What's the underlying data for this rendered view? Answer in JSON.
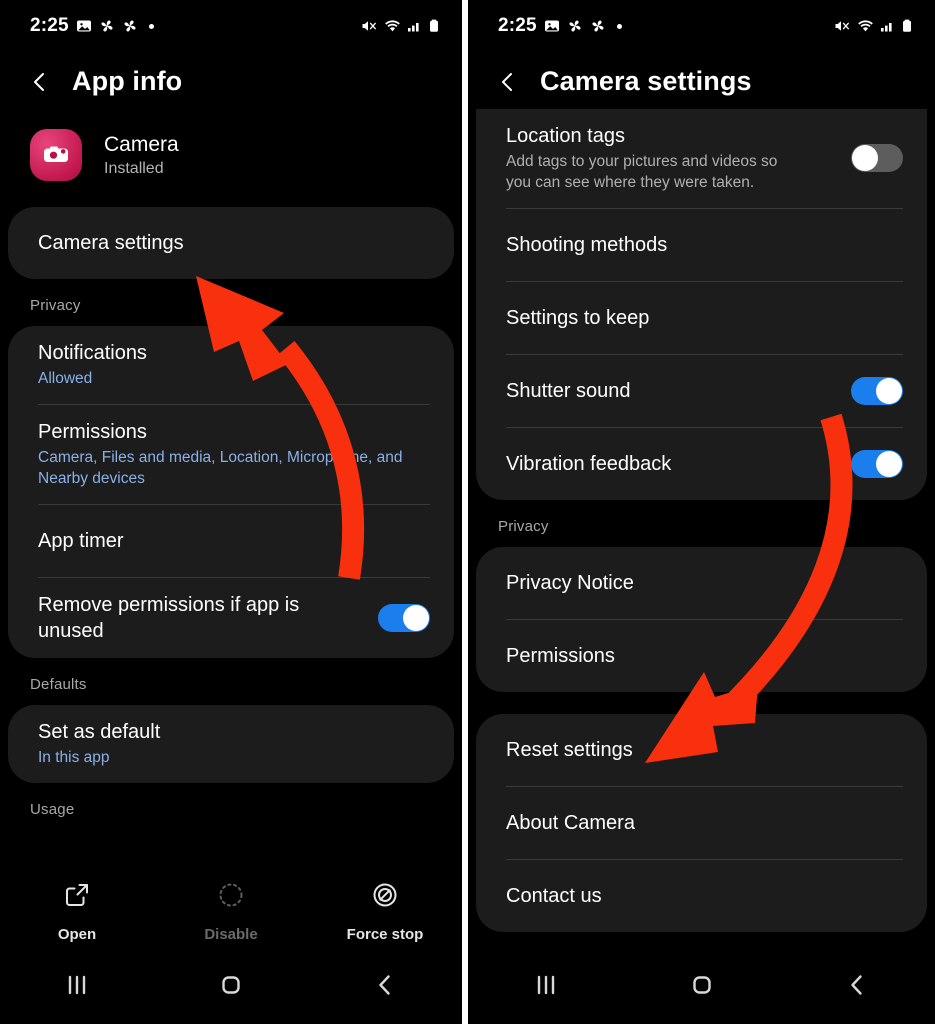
{
  "accent": {
    "arrow_red": "#f8300d",
    "toggle_on_blue": "#1a7fed",
    "toggle_off_grey": "#5d5d5d",
    "link_blue": "#8ab0e8",
    "card_bg": "#1c1c1c",
    "screen_bg": "#000000",
    "app_icon_pink": "#c2184f"
  },
  "status_bar": {
    "time": "2:25",
    "left_icons": [
      "photo-icon",
      "pinwheel-icon",
      "pinwheel-icon",
      "dot-icon"
    ],
    "right_icons": [
      "mute-icon",
      "wifi-icon",
      "signal-icon",
      "battery-icon"
    ]
  },
  "left_panel": {
    "appbar": {
      "back_icon": "back-chevron-icon",
      "title": "App info"
    },
    "app_header": {
      "icon": "camera-app-icon",
      "name": "Camera",
      "status": "Installed"
    },
    "primary_card": {
      "rows": [
        {
          "title": "Camera settings"
        }
      ]
    },
    "sections": [
      {
        "label": "Privacy",
        "rows": [
          {
            "title": "Notifications",
            "sub": "Allowed",
            "sub_style": "link"
          },
          {
            "title": "Permissions",
            "sub": "Camera, Files and media, Location, Microphone, and Nearby devices",
            "sub_style": "link"
          },
          {
            "title": "App timer"
          },
          {
            "title": "Remove permissions if app is unused",
            "toggle": "on"
          }
        ]
      },
      {
        "label": "Defaults",
        "rows": [
          {
            "title": "Set as default",
            "sub": "In this app",
            "sub_style": "link"
          }
        ]
      },
      {
        "label": "Usage",
        "rows": []
      }
    ],
    "action_bar": [
      {
        "label": "Open",
        "icon": "open-external-icon",
        "enabled": true
      },
      {
        "label": "Disable",
        "icon": "disable-dashed-circle-icon",
        "enabled": false
      },
      {
        "label": "Force stop",
        "icon": "force-stop-block-icon",
        "enabled": true
      }
    ]
  },
  "right_panel": {
    "appbar": {
      "back_icon": "back-chevron-icon",
      "title": "Camera settings"
    },
    "top_card": {
      "rows": [
        {
          "title": "Location tags",
          "sub": "Add tags to your pictures and videos so you can see where they were taken.",
          "sub_style": "grey",
          "toggle": "off"
        },
        {
          "title": "Shooting methods"
        },
        {
          "title": "Settings to keep"
        },
        {
          "title": "Shutter sound",
          "toggle": "on"
        },
        {
          "title": "Vibration feedback",
          "toggle": "on"
        }
      ]
    },
    "sections": [
      {
        "label": "Privacy",
        "rows": [
          {
            "title": "Privacy Notice"
          },
          {
            "title": "Permissions"
          }
        ]
      }
    ],
    "bottom_card": {
      "rows": [
        {
          "title": "Reset settings"
        },
        {
          "title": "About Camera"
        },
        {
          "title": "Contact us"
        }
      ]
    }
  },
  "navbar": {
    "buttons": [
      {
        "name": "recents-button",
        "icon": "recents-bars-icon"
      },
      {
        "name": "home-button",
        "icon": "home-square-icon"
      },
      {
        "name": "back-button",
        "icon": "back-chevron-icon"
      }
    ]
  },
  "annotations": [
    {
      "name": "arrow-to-camera-settings",
      "target": "Camera settings",
      "color": "#f8300d"
    },
    {
      "name": "arrow-to-reset-settings",
      "target": "Reset settings",
      "color": "#f8300d"
    }
  ]
}
